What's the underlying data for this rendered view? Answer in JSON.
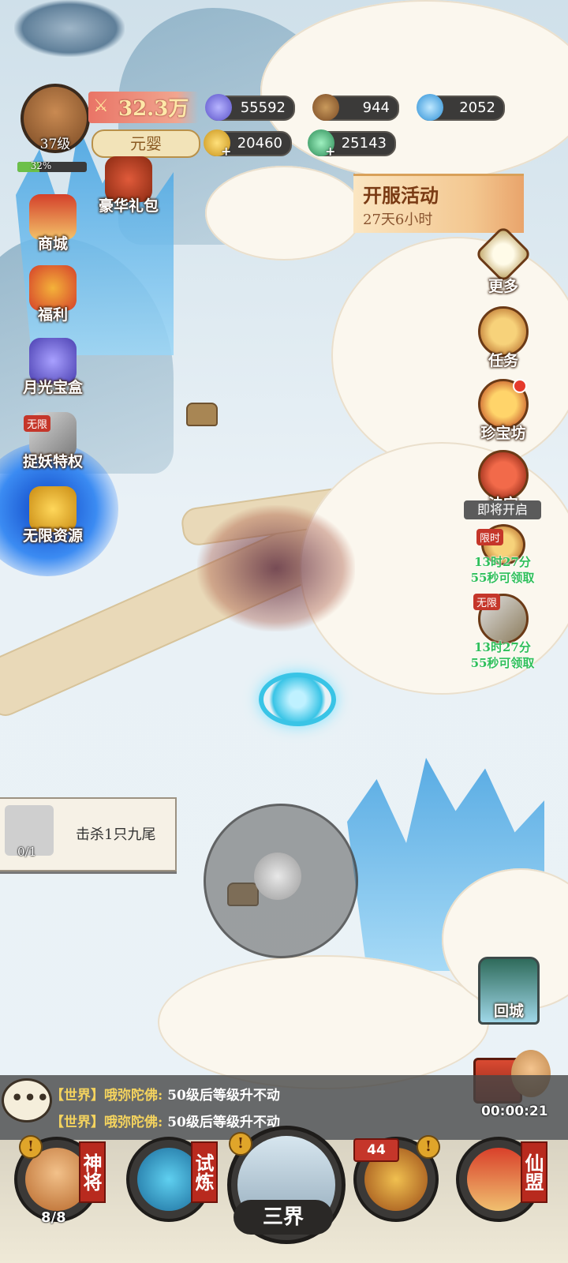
{
  "hud": {
    "level": "37级",
    "exp_percent": "32%",
    "exp_fraction": 0.32,
    "power": "32.3万",
    "realm": "元婴",
    "resources": {
      "spirit_orb": "55592",
      "wood": "944",
      "crystal": "2052",
      "gold": "20460",
      "jade": "25143"
    }
  },
  "left_menu": {
    "gift": "豪华礼包",
    "shop": "商城",
    "welfare": "福利",
    "moonlight_box": "月光宝盒",
    "demon_privilege": "捉妖特权",
    "demon_privilege_tag": "无限",
    "infinite_resources": "无限资源"
  },
  "event": {
    "title": "开服活动",
    "time": "27天6小时"
  },
  "right_menu": {
    "more": "更多",
    "tasks": "任务",
    "treasure_shop": "珍宝坊",
    "magic_item": "法宝",
    "coming_soon": "即将开启",
    "limited_tag": "限时",
    "limited_timer_1": "13时27分",
    "limited_timer_2": "55秒可领取",
    "unlimited_tag": "无限",
    "unlimited_timer_1": "13时27分",
    "unlimited_timer_2": "55秒可领取"
  },
  "quest": {
    "text": "击杀1只九尾",
    "progress": "0/1"
  },
  "return_city": "回城",
  "chest_timer": "00:00:21",
  "chat": {
    "lines": [
      {
        "channel": "【世界】",
        "name": "哦弥陀佛:",
        "msg": "50级后等级升不动"
      },
      {
        "channel": "【世界】",
        "name": "哦弥陀佛:",
        "msg": "50级后等级升不动"
      }
    ]
  },
  "nav": {
    "generals": "神将",
    "generals_count": "8/8",
    "trial": "试炼",
    "three_realms": "三界",
    "chest_badge": "44",
    "alliance": "仙盟"
  },
  "colors": {
    "accent_red": "#c5362a",
    "timer_green": "#2fbf5a",
    "gold_text": "#f4d35e"
  }
}
